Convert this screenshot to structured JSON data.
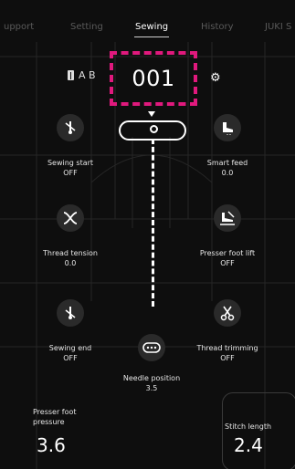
{
  "nav": {
    "tabs": [
      {
        "label": "upport"
      },
      {
        "label": "Setting"
      },
      {
        "label": "Sewing"
      },
      {
        "label": "History"
      },
      {
        "label": "JUKI S"
      }
    ],
    "active_tab": "Sewing"
  },
  "program": {
    "ab_label": "A B",
    "number": "001",
    "highlight_color": "#e0197d"
  },
  "functions": {
    "sewing_start": {
      "title": "Sewing start",
      "value": "OFF",
      "icon": "needle-start-icon"
    },
    "smart_feed": {
      "title": "Smart feed",
      "value": "0.0",
      "icon": "boot-feed-icon"
    },
    "thread_tension": {
      "title": "Thread tension",
      "value": "0.0",
      "icon": "tension-icon"
    },
    "presser_foot_lift": {
      "title": "Presser foot lift",
      "value": "OFF",
      "icon": "presser-lift-icon"
    },
    "sewing_end": {
      "title": "Sewing end",
      "value": "OFF",
      "icon": "needle-end-icon"
    },
    "thread_trimming": {
      "title": "Thread trimming",
      "value": "OFF",
      "icon": "scissors-icon"
    },
    "needle_position": {
      "title": "Needle position",
      "value": "3.5",
      "icon": "needle-position-icon"
    }
  },
  "bottom": {
    "presser_foot_pressure": {
      "title_line1": "Presser foot",
      "title_line2": "pressure",
      "value": "3.6"
    },
    "stitch_length": {
      "title": "Stitch length",
      "value": "2.4"
    }
  }
}
